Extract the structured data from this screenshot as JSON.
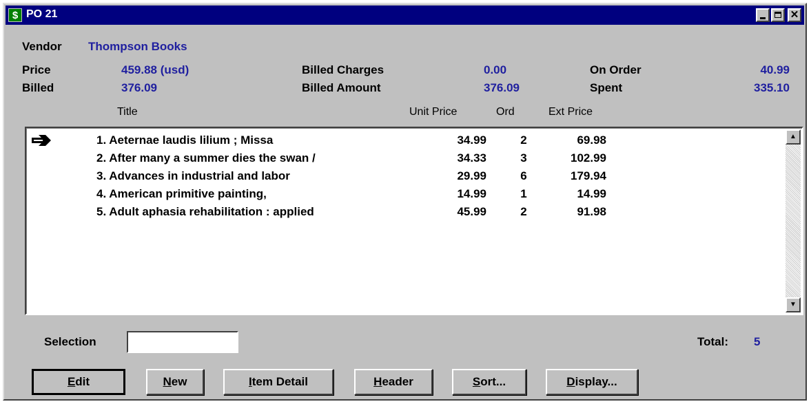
{
  "window": {
    "title": "PO 21",
    "icon_glyph": "$",
    "icon_name": "dollar-icon"
  },
  "header": {
    "vendor_label": "Vendor",
    "vendor_value": "Thompson Books",
    "price_label": "Price",
    "price_value": "459.88  (usd)",
    "billed_label": "Billed",
    "billed_value": "376.09",
    "billed_charges_label": "Billed Charges",
    "billed_charges_value": "0.00",
    "billed_amount_label": "Billed Amount",
    "billed_amount_value": "376.09",
    "on_order_label": "On Order",
    "on_order_value": "40.99",
    "spent_label": "Spent",
    "spent_value": "335.10"
  },
  "columns": {
    "title": "Title",
    "unit_price": "Unit Price",
    "ord": "Ord",
    "ext_price": "Ext Price"
  },
  "rows": [
    {
      "title": "1. Aeternae laudis lilium ; Missa",
      "unit_price": "34.99",
      "ord": "2",
      "ext_price": "69.98"
    },
    {
      "title": "2. After many a summer dies the swan /",
      "unit_price": "34.33",
      "ord": "3",
      "ext_price": "102.99"
    },
    {
      "title": "3. Advances in industrial and labor",
      "unit_price": "29.99",
      "ord": "6",
      "ext_price": "179.94"
    },
    {
      "title": "4. American primitive painting,",
      "unit_price": "14.99",
      "ord": "1",
      "ext_price": "14.99"
    },
    {
      "title": "5. Adult aphasia rehabilitation : applied",
      "unit_price": "45.99",
      "ord": "2",
      "ext_price": "91.98"
    }
  ],
  "selection": {
    "label": "Selection",
    "value": ""
  },
  "total": {
    "label": "Total:",
    "value": "5"
  },
  "buttons": {
    "edit": {
      "key": "E",
      "rest": "dit"
    },
    "new": {
      "key": "N",
      "rest": "ew"
    },
    "item_detail": {
      "key": "I",
      "rest": "tem Detail"
    },
    "header": {
      "key": "H",
      "rest": "eader"
    },
    "sort": {
      "key": "S",
      "rest": "ort..."
    },
    "display": {
      "key": "D",
      "rest": "isplay..."
    }
  },
  "colors": {
    "title_bar": "#00007f",
    "value_text": "#1f1f9f",
    "window_face": "#c0c0c0"
  }
}
